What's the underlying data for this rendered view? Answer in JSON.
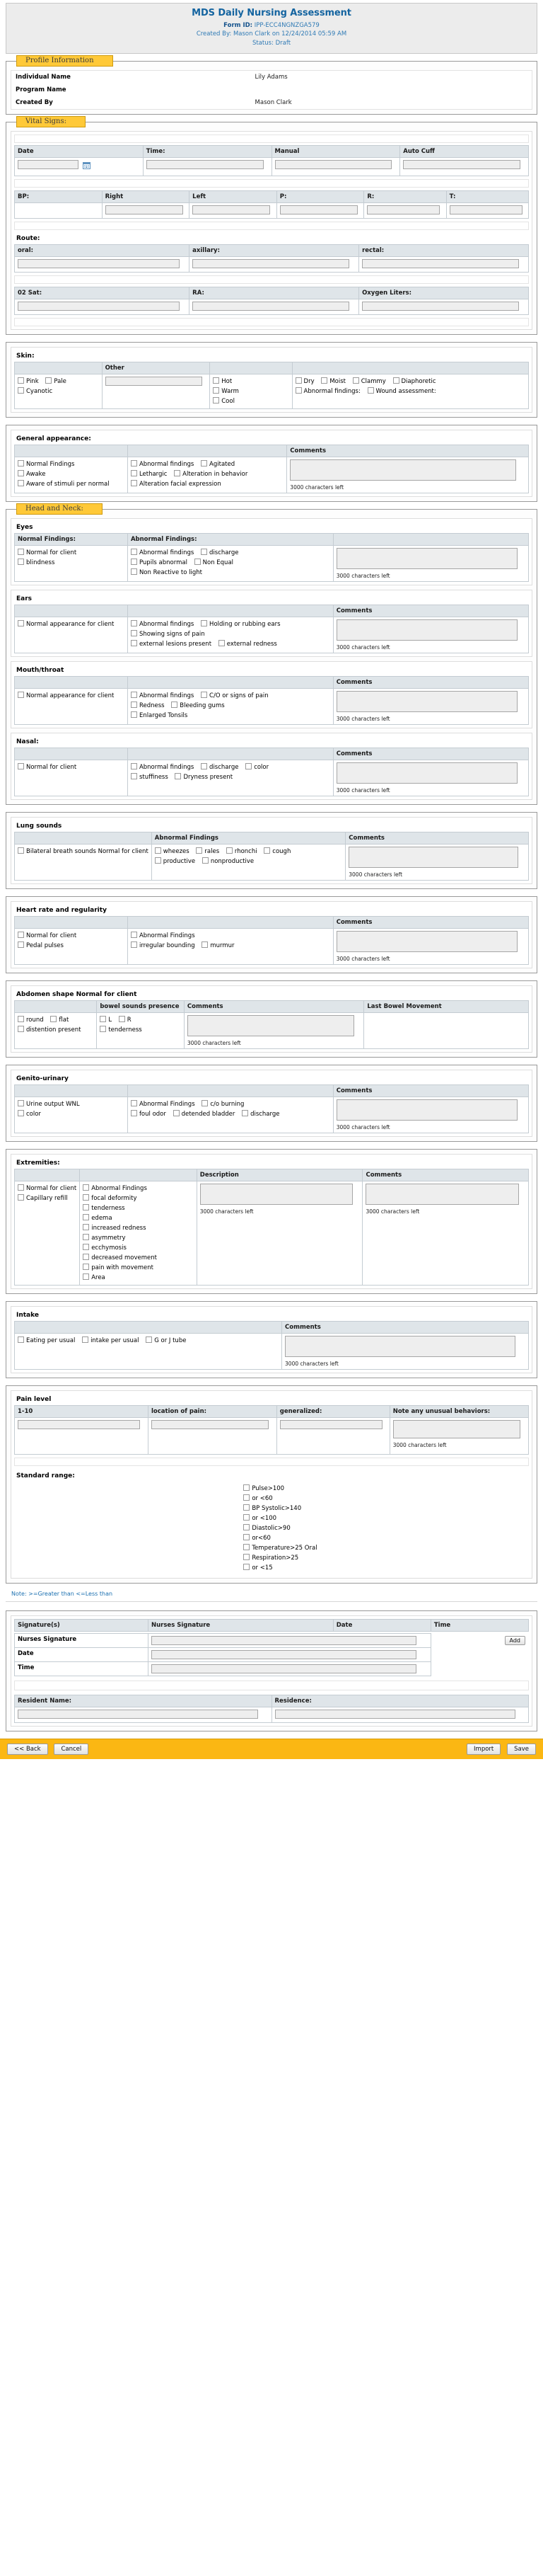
{
  "header": {
    "title": "MDS Daily Nursing Assessment",
    "form_id_label": "Form ID:",
    "form_id": "IPP-ECC4NGNZGA579",
    "created_by_line": "Created By: Mason Clark  on 12/24/2014 05:59 AM",
    "status_line": "Status: Draft",
    "accent_color": "#1464a0"
  },
  "profile": {
    "legend": "Profile Information",
    "rows": [
      {
        "label": "Individual Name",
        "value": "Lily Adams"
      },
      {
        "label": "Program Name",
        "value": ""
      },
      {
        "label": "Created By",
        "value": "Mason Clark"
      }
    ]
  },
  "vitals": {
    "legend": "Vital Signs:",
    "row1": {
      "headers": [
        "Date",
        "Time:",
        "Manual",
        "Auto Cuff"
      ],
      "values": [
        "",
        "",
        "",
        ""
      ]
    },
    "row2": {
      "headers": [
        "BP:",
        "Right",
        "Left",
        "P:",
        "R:",
        "T:"
      ],
      "values": [
        "",
        "",
        "",
        "",
        "",
        ""
      ]
    },
    "row3": {
      "label": "Route:",
      "headers": [
        "oral:",
        "axillary:",
        "rectal:"
      ],
      "values": [
        "",
        "",
        ""
      ]
    },
    "row4": {
      "headers": [
        "02 Sat:",
        "RA:",
        "Oxygen Liters:"
      ],
      "values": [
        "",
        "",
        ""
      ]
    }
  },
  "skin": {
    "label": "Skin:",
    "other_header": "Other",
    "other_value": "",
    "col1": [
      "Pink",
      "Pale",
      "Cyanotic"
    ],
    "col3": [
      "Hot",
      "Warm",
      "Cool"
    ],
    "col4": [
      "Dry",
      "Moist",
      "Clammy",
      "Diaphoretic",
      "Abnormal findings:",
      "Wound assessment:"
    ],
    "general": {
      "label": "General appearance:",
      "comments_header": "Comments",
      "col1": [
        "Normal Findings",
        "Awake",
        "Aware of stimuli per normal"
      ],
      "col2": [
        "Abnormal findings",
        "Agitated",
        "Lethargic",
        "Alteration in behavior",
        "Alteration facial expression"
      ],
      "comment_value": "",
      "charcount": "3000 characters left"
    }
  },
  "head_neck": {
    "legend": "Head and Neck:",
    "eyes": {
      "label": "Eyes",
      "normal_header": "Normal Findings:",
      "abnormal_header": "Abnormal Findings:",
      "normal": [
        "Normal for client",
        "blindness"
      ],
      "abnormal": [
        "Abnormal findings",
        "discharge",
        "Pupils abnormal",
        "Non Equal",
        "Non Reactive to light"
      ],
      "comment_value": "",
      "charcount": "3000 characters left"
    },
    "ears": {
      "label": "Ears",
      "comments_header": "Comments",
      "normal": [
        "Normal appearance for client"
      ],
      "abnormal": [
        "Abnormal findings",
        "Holding or rubbing ears",
        "Showing signs of pain",
        "external lesions present",
        "external redness"
      ],
      "comment_value": "",
      "charcount": "3000 characters left"
    },
    "mouth": {
      "label": "Mouth/throat",
      "comments_header": "Comments",
      "normal": [
        "Normal appearance for client"
      ],
      "abnormal": [
        "Abnormal findings",
        "C/O or signs of pain",
        "Redness",
        "Bleeding gums",
        "Enlarged Tonsils"
      ],
      "comment_value": "",
      "charcount": "3000 characters left"
    },
    "nasal": {
      "label": "Nasal:",
      "comments_header": "Comments",
      "normal": [
        "Normal for client"
      ],
      "abnormal": [
        "Abnormal findings",
        "discharge",
        "color",
        "stuffiness",
        "Dryness present"
      ],
      "comment_value": "",
      "charcount": "3000 characters left"
    }
  },
  "lung_sounds": {
    "label": "Lung sounds",
    "abnormal_header": "Abnormal Findings",
    "comments_header": "Comments",
    "normal": [
      "Bilateral breath sounds Normal for client"
    ],
    "abnormal": [
      "wheezes",
      "rales",
      "rhonchi",
      "cough",
      "productive",
      "nonproductive"
    ],
    "comment_value": "",
    "charcount": "3000 characters left"
  },
  "heart": {
    "label": "Heart rate and regularity",
    "comments_header": "Comments",
    "normal": [
      "Normal for client",
      "Pedal pulses"
    ],
    "abnormal": [
      "Abnormal Findings",
      "irregular bounding",
      "murmur"
    ],
    "comment_value": "",
    "charcount": "3000 characters left"
  },
  "abdomen": {
    "label": "Abdomen shape Normal for client",
    "headers": [
      "",
      "bowel sounds presence",
      "Comments",
      "Last Bowel Movement"
    ],
    "shape": [
      "round",
      "flat",
      "distention present"
    ],
    "bowel": [
      "L",
      "R",
      "tenderness"
    ],
    "comment_value": "",
    "charcount": "3000 characters left",
    "last_bm_value": ""
  },
  "genito": {
    "label": "Genito-urinary",
    "comments_header": "Comments",
    "normal": [
      "Urine output WNL",
      "color"
    ],
    "abnormal": [
      "Abnormal Findings",
      "c/o burning",
      "foul odor",
      "detended bladder",
      "discharge"
    ],
    "comment_value": "",
    "charcount": "3000 characters left"
  },
  "extremities": {
    "label": "Extremities:",
    "description_header": "Description",
    "comments_header": "Comments",
    "normal": [
      "Normal for client",
      "Capillary refill"
    ],
    "abnormal": [
      "Abnormal Findings",
      "focal deformity",
      "tenderness",
      "edema",
      "increased redness",
      "asymmetry",
      "ecchymosis",
      "decreased movement",
      "pain with movement",
      "Area"
    ],
    "description_value": "",
    "description_charcount": "3000 characters left",
    "comment_value": "",
    "comment_charcount": "3000 characters left"
  },
  "intake": {
    "label": "Intake",
    "comments_header": "Comments",
    "items": [
      "Eating per usual",
      "intake per usual",
      "G or J tube"
    ],
    "comment_value": "",
    "charcount": "3000 characters left"
  },
  "pain": {
    "label": "Pain level",
    "headers": [
      "1-10",
      "location of pain:",
      "generalized:",
      "Note any unusual behaviors:"
    ],
    "values": [
      "",
      "",
      "",
      ""
    ],
    "charcount": "3000 characters left",
    "standard_range_label": "Standard range:",
    "standard_range": [
      "Pulse>100",
      "or <60",
      "BP Systolic>140",
      "or <100",
      "Diastolic>90",
      "or<60",
      "Temperature>25 Oral",
      "Respiration>25",
      "or <15"
    ]
  },
  "note": "Note: >=Greater than  <=Less than",
  "signature": {
    "headers": [
      "Signature(s)",
      "Nurses Signature",
      "Date",
      "Time"
    ],
    "rows": [
      {
        "label": "Nurses Signature",
        "value": ""
      },
      {
        "label": "Date",
        "value": ""
      },
      {
        "label": "Time",
        "value": ""
      }
    ],
    "add_button": "Add"
  },
  "resident": {
    "name_label": "Resident Name:",
    "residence_label": "Residence:",
    "name_value": "",
    "residence_value": ""
  },
  "actions": {
    "back": "<< Back",
    "cancel": "Cancel",
    "import": "Import",
    "save": "Save"
  }
}
